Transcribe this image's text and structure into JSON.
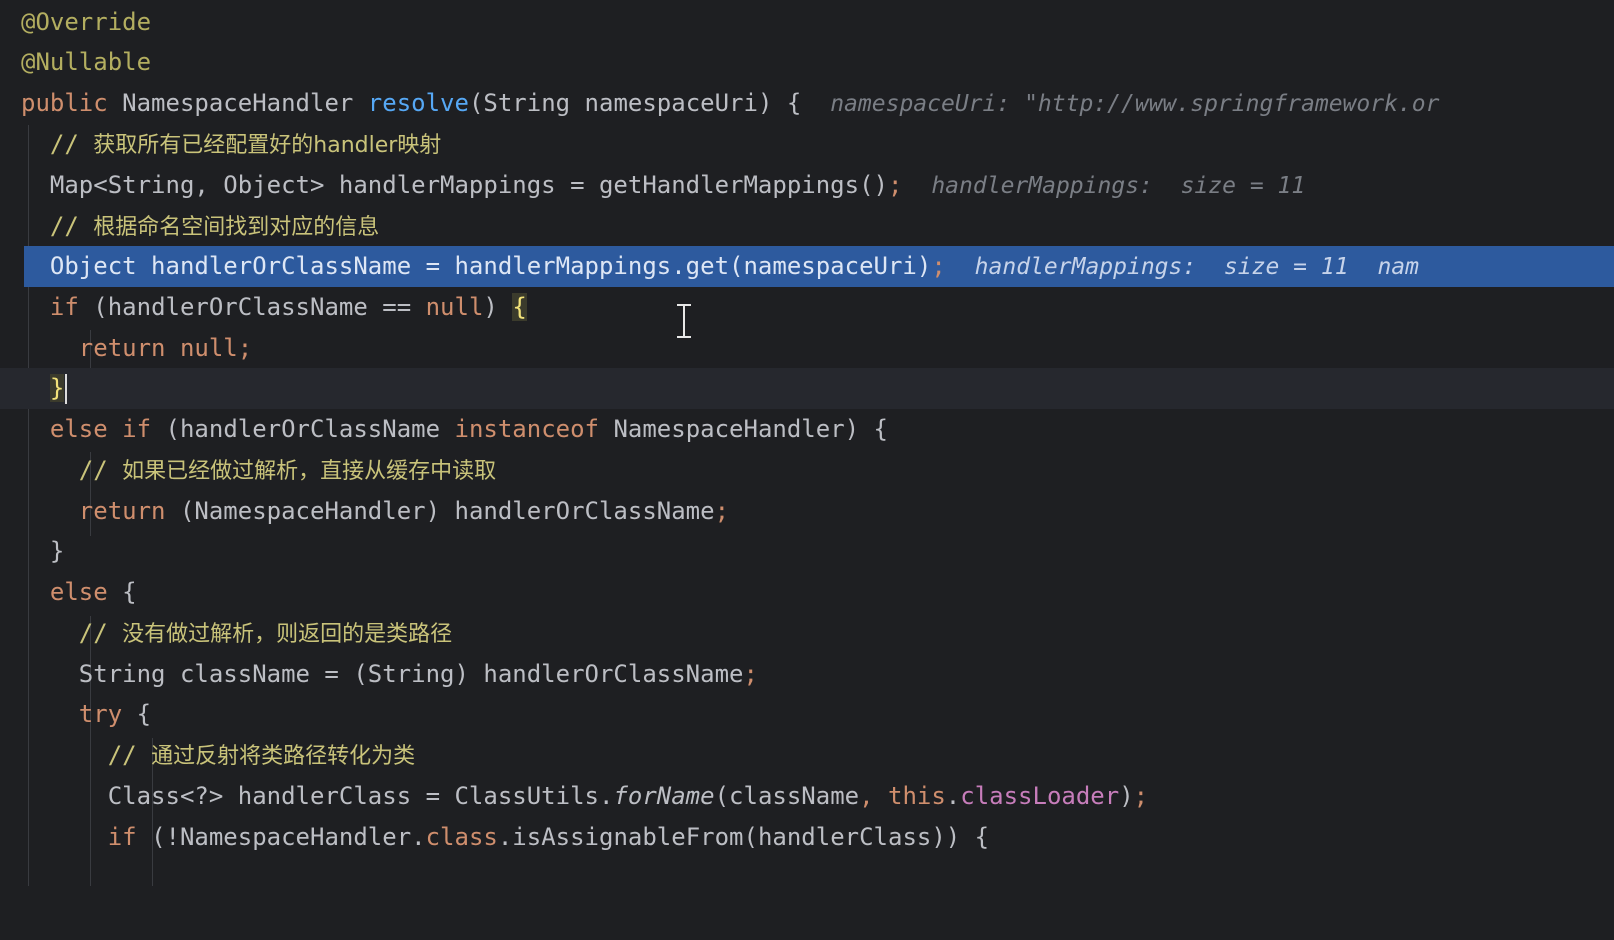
{
  "editor": {
    "l1": {
      "text": "@Override"
    },
    "l2": {
      "text": "@Nullable"
    },
    "l3": {
      "kw_public": "public",
      "type": "NamespaceHandler",
      "method": "resolve",
      "params": "(String namespaceUri) {",
      "hint": "namespaceUri: \"http://www.springframework.or"
    },
    "l4": {
      "slashes": "//",
      "comment": "获取所有已经配置好的handler映射"
    },
    "l5": {
      "code": "Map<String, Object> handlerMappings = getHandlerMappings()",
      "semi": ";",
      "hint": "handlerMappings:  size = 11"
    },
    "l6": {
      "slashes": "//",
      "comment": "根据命名空间找到对应的信息"
    },
    "l7": {
      "code": "Object handlerOrClassName = handlerMappings.get(namespaceUri)",
      "semi": ";",
      "hint1": "handlerMappings:  size = 11",
      "hint2": "nam"
    },
    "l8": {
      "kw_if": "if",
      "cond": "(handlerOrClassName == ",
      "kw_null": "null",
      "close": ") ",
      "brace": "{"
    },
    "l9": {
      "kw_return": "return",
      "kw_null": "null",
      "semi": ";"
    },
    "l10": {
      "brace": "}"
    },
    "l11": {
      "kw_else": "else",
      "kw_if": "if",
      "open": "(handlerOrClassName ",
      "kw_instanceof": "instanceof",
      "rest": "NamespaceHandler) {"
    },
    "l12": {
      "slashes": "//",
      "comment": "如果已经做过解析，直接从缓存中读取"
    },
    "l13": {
      "kw_return": "return",
      "expr": "(NamespaceHandler) handlerOrClassName",
      "semi": ";"
    },
    "l14": {
      "brace": "}"
    },
    "l15": {
      "kw_else": "else",
      "brace": "{"
    },
    "l16": {
      "slashes": "//",
      "comment": "没有做过解析，则返回的是类路径"
    },
    "l17": {
      "code": "String className = (String) handlerOrClassName",
      "semi": ";"
    },
    "l18": {
      "kw_try": "try",
      "brace": "{"
    },
    "l19": {
      "slashes": "//",
      "comment": "通过反射将类路径转化为类"
    },
    "l20": {
      "pre": "Class<?> handlerClass = ClassUtils.",
      "call": "forName",
      "arg": "(className",
      "comma": ",",
      "kw_this": "this",
      "dot": ".",
      "field": "classLoader",
      "close": ")",
      "semi": ";"
    },
    "l21": {
      "kw_if": "if",
      "pre": "(!NamespaceHandler.",
      "kw_class": "class",
      "rest": ".isAssignableFrom(handlerClass)) {"
    }
  }
}
